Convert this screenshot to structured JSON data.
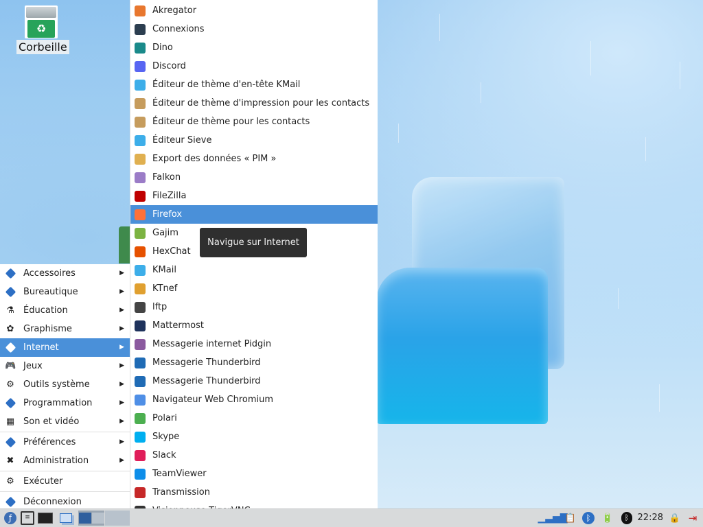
{
  "desktop": {
    "trash_label": "Corbeille"
  },
  "main_menu": {
    "items": [
      {
        "label": "Accessoires",
        "icon": "accessories-icon"
      },
      {
        "label": "Bureautique",
        "icon": "office-icon"
      },
      {
        "label": "Éducation",
        "icon": "flask-icon"
      },
      {
        "label": "Graphisme",
        "icon": "graphics-icon"
      },
      {
        "label": "Internet",
        "icon": "internet-icon"
      },
      {
        "label": "Jeux",
        "icon": "gamepad-icon"
      },
      {
        "label": "Outils système",
        "icon": "gear-icon"
      },
      {
        "label": "Programmation",
        "icon": "programming-icon"
      },
      {
        "label": "Son et vidéo",
        "icon": "film-icon"
      },
      {
        "label": "Préférences",
        "icon": "preferences-icon"
      },
      {
        "label": "Administration",
        "icon": "tools-icon"
      },
      {
        "label": "Exécuter",
        "icon": "run-icon"
      },
      {
        "label": "Déconnexion",
        "icon": "logout-icon"
      }
    ],
    "active": "Internet"
  },
  "apps_menu": {
    "items": [
      {
        "label": "Akregator",
        "icon": "akregator-icon",
        "color": "#e8772e"
      },
      {
        "label": "Connexions",
        "icon": "connexions-icon",
        "color": "#2c3e50"
      },
      {
        "label": "Dino",
        "icon": "dino-icon",
        "color": "#1a8a8a"
      },
      {
        "label": "Discord",
        "icon": "discord-icon",
        "color": "#5865f2"
      },
      {
        "label": "Éditeur de thème d'en-tête KMail",
        "icon": "kmail-theme-icon",
        "color": "#3daee9"
      },
      {
        "label": "Éditeur de thème d'impression pour les contacts",
        "icon": "contacts-print-theme-icon",
        "color": "#c69c5d"
      },
      {
        "label": "Éditeur de thème pour les contacts",
        "icon": "contacts-theme-icon",
        "color": "#c69c5d"
      },
      {
        "label": "Éditeur Sieve",
        "icon": "sieve-icon",
        "color": "#3daee9"
      },
      {
        "label": "Export des données « PIM »",
        "icon": "pim-export-icon",
        "color": "#e0b050"
      },
      {
        "label": "Falkon",
        "icon": "falkon-icon",
        "color": "#9b7cc7"
      },
      {
        "label": "FileZilla",
        "icon": "filezilla-icon",
        "color": "#bf0000"
      },
      {
        "label": "Firefox",
        "icon": "firefox-icon",
        "color": "#ff7139"
      },
      {
        "label": "Gajim",
        "icon": "gajim-icon",
        "color": "#7cb342"
      },
      {
        "label": "HexChat",
        "icon": "hexchat-icon",
        "color": "#e65100"
      },
      {
        "label": "KMail",
        "icon": "kmail-icon",
        "color": "#3daee9"
      },
      {
        "label": "KTnef",
        "icon": "ktnef-icon",
        "color": "#e0a030"
      },
      {
        "label": "lftp",
        "icon": "lftp-icon",
        "color": "#444444"
      },
      {
        "label": "Mattermost",
        "icon": "mattermost-icon",
        "color": "#1e325c"
      },
      {
        "label": "Messagerie internet Pidgin",
        "icon": "pidgin-icon",
        "color": "#8b5a9f"
      },
      {
        "label": "Messagerie Thunderbird",
        "icon": "thunderbird-icon",
        "color": "#1f6bb5"
      },
      {
        "label": "Messagerie Thunderbird",
        "icon": "thunderbird-icon",
        "color": "#1f6bb5"
      },
      {
        "label": "Navigateur Web Chromium",
        "icon": "chromium-icon",
        "color": "#4f8fe6"
      },
      {
        "label": "Polari",
        "icon": "polari-icon",
        "color": "#4caf50"
      },
      {
        "label": "Skype",
        "icon": "skype-icon",
        "color": "#00aff0"
      },
      {
        "label": "Slack",
        "icon": "slack-icon",
        "color": "#e01e5a"
      },
      {
        "label": "TeamViewer",
        "icon": "teamviewer-icon",
        "color": "#0e8ee9"
      },
      {
        "label": "Transmission",
        "icon": "transmission-icon",
        "color": "#c62828"
      },
      {
        "label": "Visionneuse TigerVNC",
        "icon": "tigervnc-icon",
        "color": "#333333"
      }
    ],
    "active": "Firefox",
    "tooltip": "Navigue sur Internet"
  },
  "taskbar": {
    "clock": "22:28"
  }
}
